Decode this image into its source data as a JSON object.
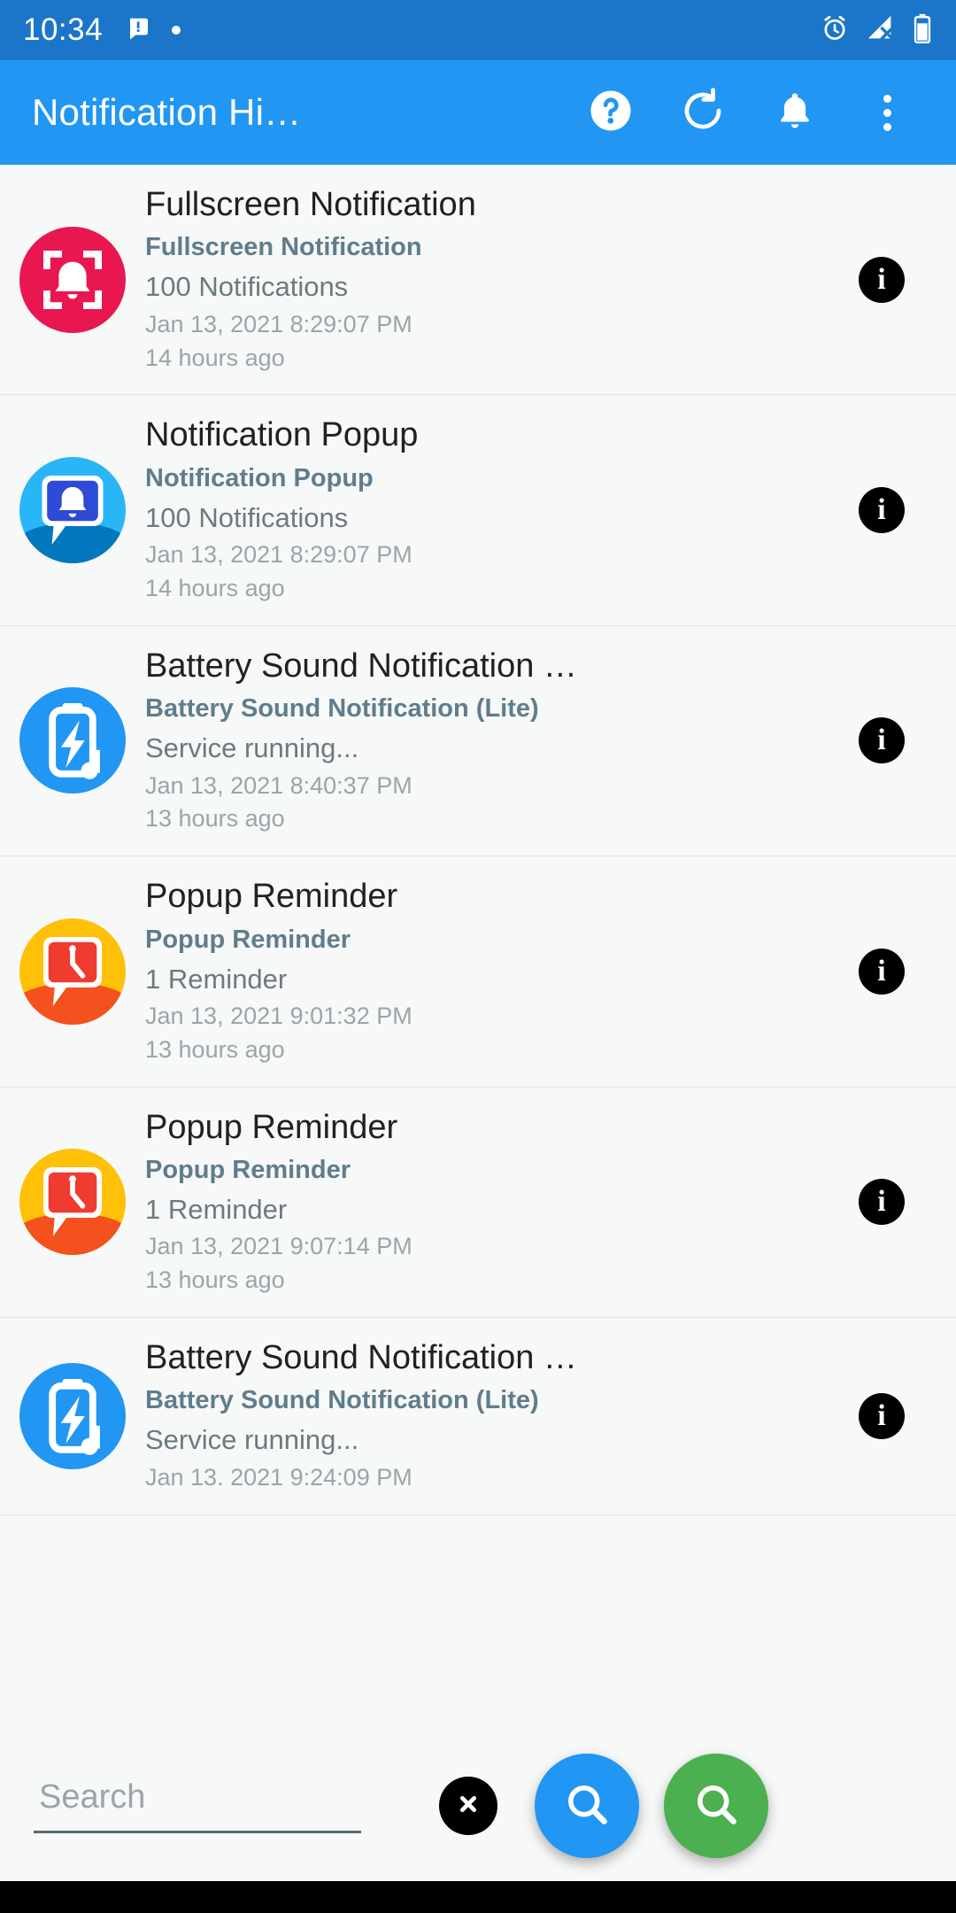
{
  "status_bar": {
    "time": "10:34",
    "icons": [
      "message-icon",
      "dot-icon",
      "alarm-icon",
      "signal-off-icon",
      "battery-icon"
    ],
    "background": "#1b76c9"
  },
  "app_bar": {
    "title": "Notification Hi…",
    "background": "#2196f3",
    "actions": [
      {
        "name": "help-icon",
        "label": "Help"
      },
      {
        "name": "refresh-icon",
        "label": "Refresh"
      },
      {
        "name": "bell-icon",
        "label": "Notifications"
      },
      {
        "name": "overflow-menu-icon",
        "label": "More options"
      }
    ]
  },
  "list": {
    "items": [
      {
        "title": "Fullscreen Notification",
        "app": "Fullscreen Notification",
        "count": "100 Notifications",
        "date": "Jan 13, 2021 8:29:07 PM",
        "ago": "14 hours ago",
        "icon": "fullscreen-bell-icon",
        "icon_color": "#e8174f"
      },
      {
        "title": "Notification Popup",
        "app": "Notification Popup",
        "count": "100 Notifications",
        "date": "Jan 13, 2021 8:29:07 PM",
        "ago": "14 hours ago",
        "icon": "popup-bell-icon",
        "icon_color": "#29b6f6"
      },
      {
        "title": "Battery Sound Notification (Lit…",
        "app": "Battery Sound Notification (Lite)",
        "count": "Service running...",
        "date": "Jan 13, 2021 8:40:37 PM",
        "ago": "13 hours ago",
        "icon": "battery-sound-icon",
        "icon_color": "#2196f3"
      },
      {
        "title": "Popup Reminder",
        "app": "Popup Reminder",
        "count": "1 Reminder",
        "date": "Jan 13, 2021 9:01:32 PM",
        "ago": "13 hours ago",
        "icon": "reminder-clock-icon",
        "icon_color": "#ffc107"
      },
      {
        "title": "Popup Reminder",
        "app": "Popup Reminder",
        "count": "1 Reminder",
        "date": "Jan 13, 2021 9:07:14 PM",
        "ago": "13 hours ago",
        "icon": "reminder-clock-icon",
        "icon_color": "#ffc107"
      },
      {
        "title": "Battery Sound Notification (Lit…",
        "app": "Battery Sound Notification (Lite)",
        "count": "Service running...",
        "date": "Jan 13. 2021 9:24:09 PM",
        "ago": "",
        "icon": "battery-sound-icon",
        "icon_color": "#2196f3"
      }
    ],
    "info_button_label": "i"
  },
  "bottom_bar": {
    "search_placeholder": "Search",
    "search_value": "",
    "clear_label": "Clear",
    "fab_search_blue": "search-icon",
    "fab_search_green": "search-icon",
    "blue_color": "#2196f3",
    "green_color": "#4caf50"
  }
}
